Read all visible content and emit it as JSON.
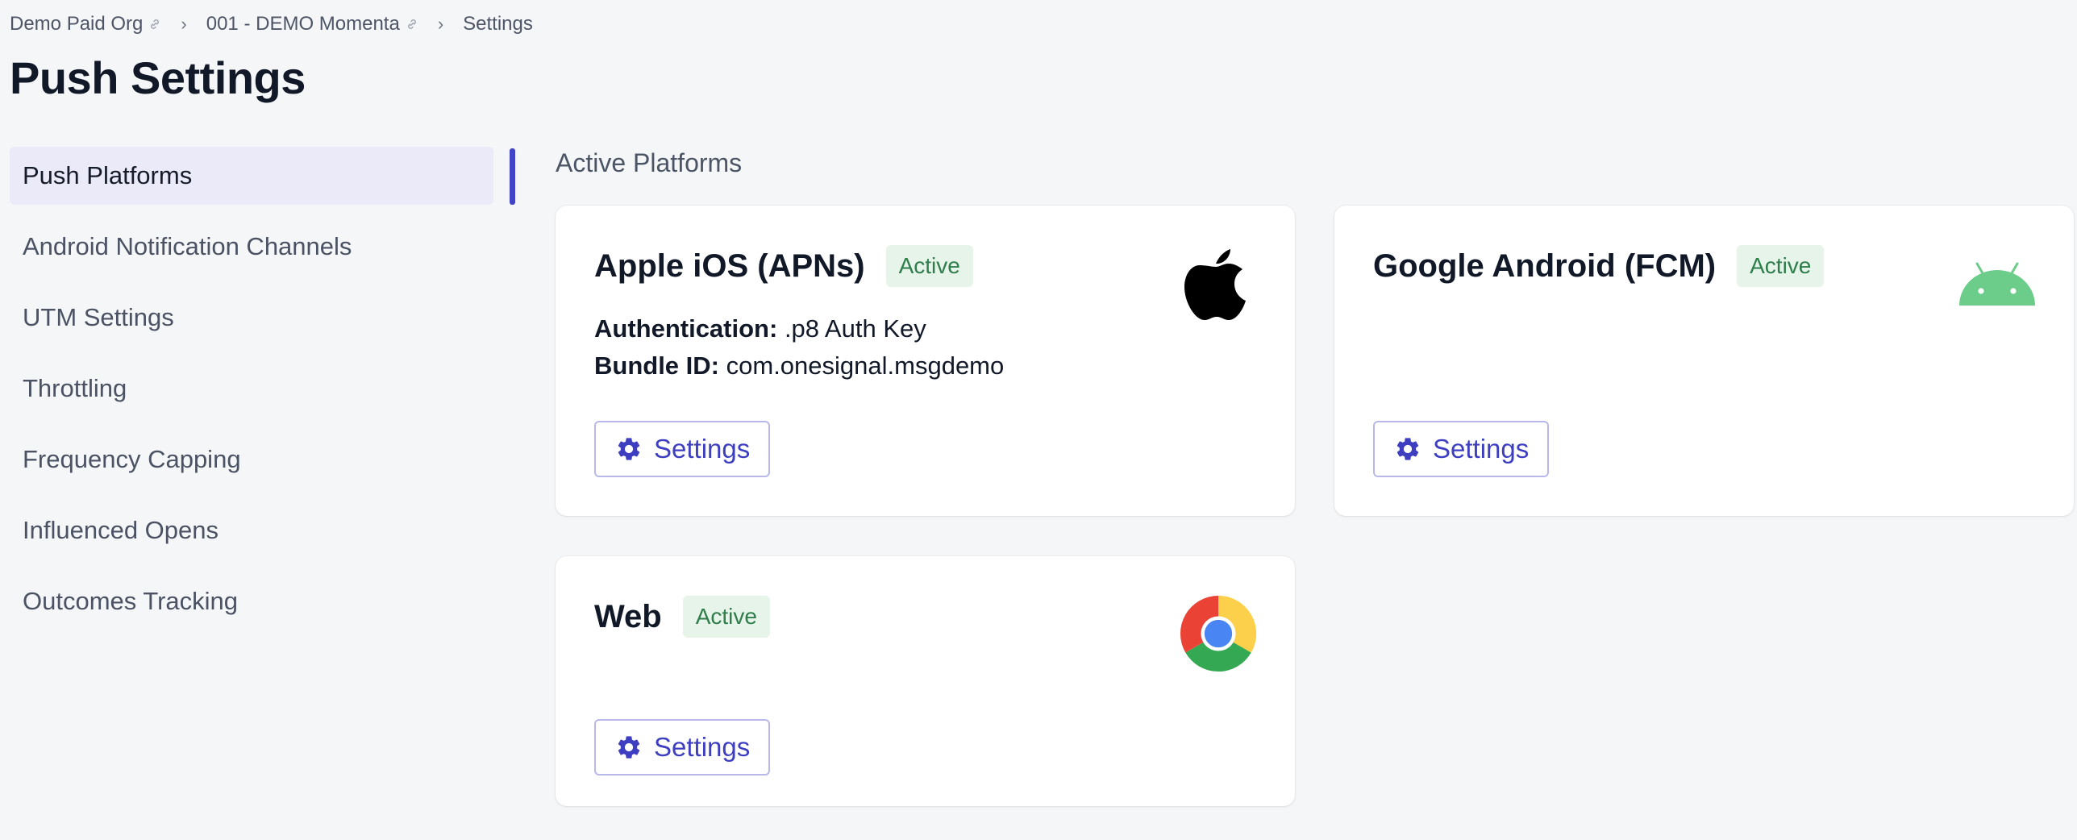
{
  "breadcrumb": {
    "items": [
      {
        "label": "Demo Paid Org"
      },
      {
        "label": "001 - DEMO Momenta"
      },
      {
        "label": "Settings"
      }
    ],
    "separator": "›"
  },
  "page": {
    "title": "Push Settings"
  },
  "sidebar": {
    "items": [
      {
        "label": "Push Platforms",
        "active": true
      },
      {
        "label": "Android Notification Channels"
      },
      {
        "label": "UTM Settings"
      },
      {
        "label": "Throttling"
      },
      {
        "label": "Frequency Capping"
      },
      {
        "label": "Influenced Opens"
      },
      {
        "label": "Outcomes Tracking"
      }
    ]
  },
  "main": {
    "section_label": "Active Platforms",
    "platforms": [
      {
        "title": "Apple iOS (APNs)",
        "status": "Active",
        "icon": "apple-logo-icon",
        "details": [
          {
            "key": "Authentication:",
            "value": ".p8 Auth Key"
          },
          {
            "key": "Bundle ID:",
            "value": "com.onesignal.msgdemo"
          }
        ],
        "button": "Settings"
      },
      {
        "title": "Google Android (FCM)",
        "status": "Active",
        "icon": "android-logo-icon",
        "button": "Settings"
      },
      {
        "title": "Web",
        "status": "Active",
        "icon": "chrome-logo-icon",
        "button": "Settings"
      }
    ]
  },
  "colors": {
    "accent": "#4244c8",
    "badge_bg": "#e6f4ea",
    "badge_text": "#2e7d4a",
    "android_green": "#6ccd8a"
  }
}
